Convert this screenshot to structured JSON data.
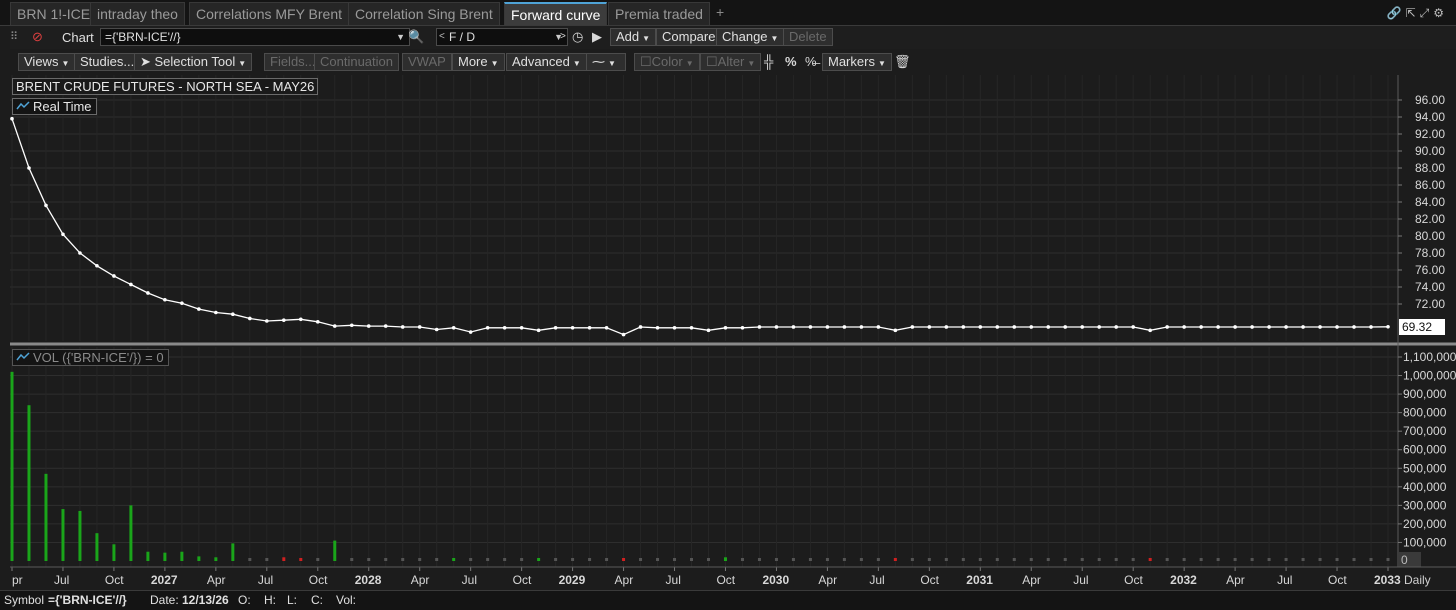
{
  "tabs": [
    {
      "label": "BRN 1!-ICE",
      "active": false
    },
    {
      "label": "intraday theo",
      "active": false
    },
    {
      "label": "Correlations MFY Brent",
      "active": false
    },
    {
      "label": "Correlation Sing Brent",
      "active": false
    },
    {
      "label": "Forward curve",
      "active": true
    },
    {
      "label": "Premia traded",
      "active": false
    }
  ],
  "tab_add": "+",
  "toolbar1": {
    "chart_label": "Chart",
    "symbol_value": "={'BRN-ICE'//}",
    "aggregation_value": "F / D",
    "add_label": "Add",
    "compare_label": "Compare",
    "change_label": "Change",
    "delete_label": "Delete"
  },
  "toolbar2": {
    "views_label": "Views",
    "studies_label": "Studies...",
    "selection_tool_label": "Selection Tool",
    "fields_label": "Fields...",
    "continuation_label": "Continuation",
    "vwap_label": "VWAP",
    "more_label": "More",
    "advanced_label": "Advanced",
    "color_label": "Color",
    "alter_label": "Alter",
    "percent_label": "%",
    "markers_label": "Markers"
  },
  "chart": {
    "title": "BRENT CRUDE FUTURES - NORTH SEA - MAY26",
    "real_time_label": "Real Time",
    "vol_label": "VOL ({'BRN-ICE'/}) = 0",
    "last_price_label": "69.32",
    "vol_last_label": "0",
    "interval_label": "Daily"
  },
  "chart_data": [
    {
      "type": "line",
      "title": "BRENT CRUDE FUTURES - NORTH SEA - MAY26",
      "series": [
        {
          "name": "Real Time",
          "values": [
            93.8,
            88.0,
            83.6,
            80.2,
            78.0,
            76.5,
            75.3,
            74.3,
            73.3,
            72.5,
            72.1,
            71.4,
            71.0,
            70.8,
            70.3,
            70.0,
            70.1,
            70.2,
            69.9,
            69.4,
            69.5,
            69.4,
            69.4,
            69.3,
            69.3,
            69.0,
            69.2,
            68.7,
            69.2,
            69.2,
            69.2,
            68.9,
            69.2,
            69.2,
            69.2,
            69.2,
            68.4,
            69.3,
            69.2,
            69.2,
            69.2,
            68.9,
            69.2,
            69.2,
            69.3,
            69.3,
            69.3,
            69.3,
            69.3,
            69.3,
            69.3,
            69.3,
            68.9,
            69.3,
            69.3,
            69.3,
            69.3,
            69.3,
            69.3,
            69.3,
            69.3,
            69.3,
            69.3,
            69.3,
            69.3,
            69.3,
            69.3,
            68.9,
            69.3,
            69.3,
            69.3,
            69.3,
            69.3,
            69.3,
            69.3,
            69.3,
            69.3,
            69.3,
            69.3,
            69.3,
            69.3,
            69.32
          ]
        }
      ],
      "ylim": [
        69.0,
        96.0
      ],
      "y_ticks": [
        "96.00",
        "94.00",
        "92.00",
        "90.00",
        "88.00",
        "86.00",
        "84.00",
        "82.00",
        "80.00",
        "78.00",
        "76.00",
        "74.00",
        "72.00"
      ],
      "last_value": "69.32",
      "grid": true
    },
    {
      "type": "bar",
      "title": "VOL ({'BRN-ICE'/}) = 0",
      "values": [
        1020000,
        840000,
        470000,
        280000,
        270000,
        150000,
        90000,
        300000,
        50000,
        45000,
        50000,
        25000,
        20000,
        95000,
        8000,
        8000,
        20000,
        15000,
        8000,
        110000,
        8000,
        8000,
        8000,
        8000,
        8000,
        8000,
        15000,
        8000,
        8000,
        8000,
        8000,
        15000,
        8000,
        8000,
        8000,
        8000,
        12000,
        8000,
        8000,
        8000,
        8000,
        8000,
        20000,
        8000,
        8000,
        8000,
        8000,
        8000,
        8000,
        8000,
        8000,
        8000,
        12000,
        8000,
        8000,
        8000,
        8000,
        8000,
        8000,
        8000,
        8000,
        8000,
        8000,
        8000,
        8000,
        8000,
        8000,
        12000,
        8000,
        8000,
        8000,
        8000,
        8000,
        8000,
        8000,
        8000,
        8000,
        8000,
        8000,
        8000,
        8000,
        8000
      ],
      "bar_colors": [
        "green",
        "green",
        "green",
        "green",
        "green",
        "green",
        "green",
        "green",
        "green",
        "green",
        "green",
        "green",
        "green",
        "green",
        "gray",
        "gray",
        "red",
        "red",
        "gray",
        "green",
        "gray",
        "gray",
        "gray",
        "gray",
        "gray",
        "gray",
        "green",
        "gray",
        "gray",
        "gray",
        "gray",
        "green",
        "gray",
        "gray",
        "gray",
        "gray",
        "red",
        "gray",
        "gray",
        "gray",
        "gray",
        "gray",
        "green",
        "gray",
        "gray",
        "gray",
        "gray",
        "gray",
        "gray",
        "gray",
        "gray",
        "gray",
        "red",
        "gray",
        "gray",
        "gray",
        "gray",
        "gray",
        "gray",
        "gray",
        "gray",
        "gray",
        "gray",
        "gray",
        "gray",
        "gray",
        "gray",
        "red",
        "gray",
        "gray",
        "gray",
        "gray",
        "gray",
        "gray",
        "gray",
        "gray",
        "gray",
        "gray",
        "gray",
        "gray",
        "gray",
        "gray"
      ],
      "ylim": [
        0,
        1100000
      ],
      "y_ticks": [
        "1,100,000",
        "1,000,000",
        "900,000",
        "800,000",
        "700,000",
        "600,000",
        "500,000",
        "400,000",
        "300,000",
        "200,000",
        "100,000"
      ],
      "grid": true
    }
  ],
  "x_axis": [
    "pr",
    "Jul",
    "Oct",
    "2027",
    "Apr",
    "Jul",
    "Oct",
    "2028",
    "Apr",
    "Jul",
    "Oct",
    "2029",
    "Apr",
    "Jul",
    "Oct",
    "2030",
    "Apr",
    "Jul",
    "Oct",
    "2031",
    "Apr",
    "Jul",
    "Oct",
    "2032",
    "Apr",
    "Jul",
    "Oct",
    "2033"
  ],
  "x_axis_bold": [
    "2027",
    "2028",
    "2029",
    "2030",
    "2031",
    "2032",
    "2033"
  ],
  "status": {
    "symbol_label": "Symbol",
    "symbol_value": "={'BRN-ICE'//}",
    "date_label": "Date:",
    "date_value": "12/13/26",
    "o_label": "O:",
    "h_label": "H:",
    "l_label": "L:",
    "c_label": "C:",
    "vol_label": "Vol:"
  },
  "colors": {
    "accent": "#4fa3d6",
    "line": "#ffffff",
    "bar_up": "#1aa51a",
    "bar_down": "#d02020",
    "bar_flat": "#555555",
    "grid": "#2e2e2e"
  },
  "icons": [
    "link-icon",
    "search-icon",
    "clock-icon",
    "play-icon",
    "cursor-icon",
    "trash-icon",
    "settings-icon"
  ]
}
